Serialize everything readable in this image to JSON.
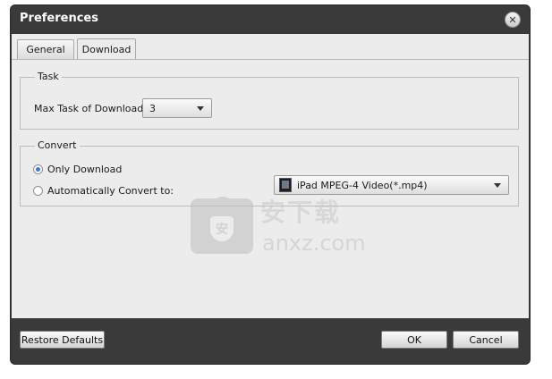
{
  "window": {
    "title": "Preferences"
  },
  "tabs": [
    {
      "label": "General",
      "selected": false
    },
    {
      "label": "Download",
      "selected": true
    }
  ],
  "task_group": {
    "legend": "Task",
    "max_task_label": "Max Task of Download:",
    "max_task_value": "3"
  },
  "convert_group": {
    "legend": "Convert",
    "options": [
      {
        "label": "Only Download",
        "checked": true
      },
      {
        "label": "Automatically Convert to:",
        "checked": false
      }
    ],
    "format_value": "iPad MPEG-4 Video(*.mp4)"
  },
  "footer": {
    "restore_label": "Restore Defaults",
    "ok_label": "OK",
    "cancel_label": "Cancel"
  },
  "watermark": {
    "cn": "安下载",
    "en": "anxz.com"
  },
  "icons": {
    "close": "close-icon",
    "format": "video-format-icon",
    "dropdown": "chevron-down-icon"
  },
  "colors": {
    "titlebar": "#3a3a3a",
    "panel": "#ececec",
    "radio_accent": "#3b78d8"
  }
}
